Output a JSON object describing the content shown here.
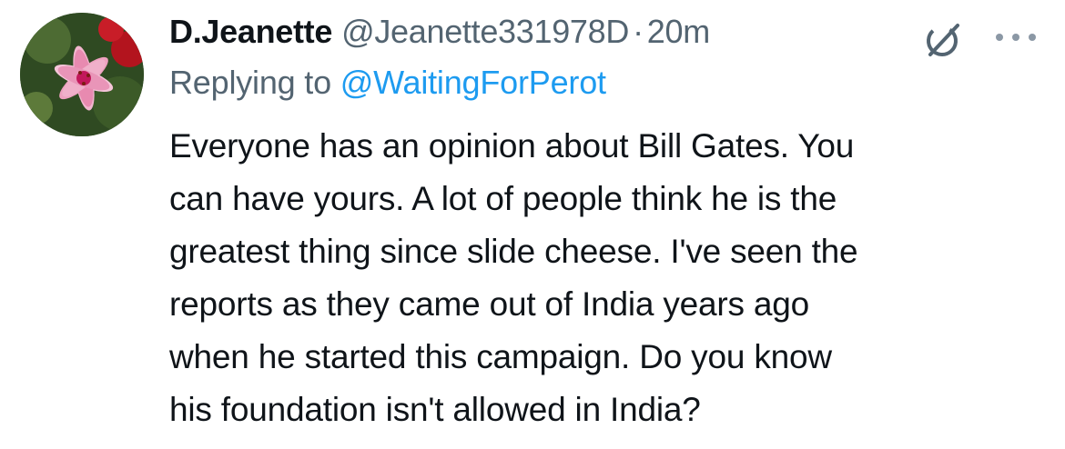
{
  "author": {
    "display_name": "D.Jeanette",
    "handle": "@Jeanette331978D",
    "separator": "·",
    "time": "20m"
  },
  "reply": {
    "prefix": "Replying to",
    "mention": "@WaitingForPerot"
  },
  "tweet": {
    "lines": [
      "Everyone has an opinion about Bill Gates. You",
      "can have yours. A lot of people think he is the",
      "greatest thing since slide cheese. I've seen the",
      "reports as they came out of India years ago",
      "when he started this campaign. Do you know",
      "his foundation isn't allowed in India?"
    ]
  },
  "icons": {
    "avatar": "avatar-lily-photo",
    "grok": "grok-icon",
    "more": "more-options-icon"
  },
  "colors": {
    "text": "#0f1419",
    "secondary": "#536471",
    "mention": "#1d9bf0",
    "background": "#ffffff"
  }
}
